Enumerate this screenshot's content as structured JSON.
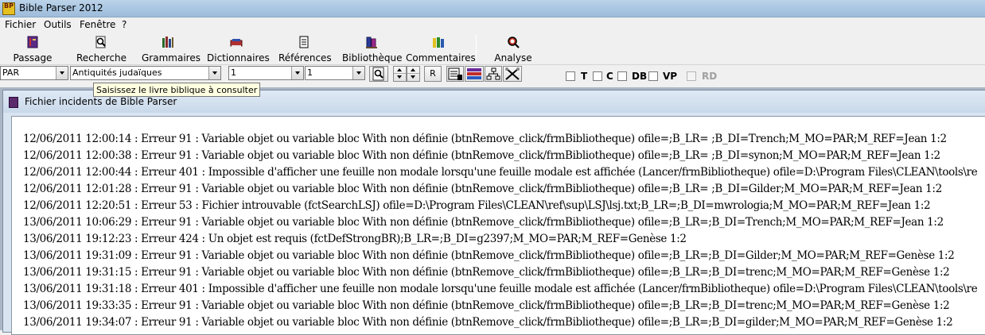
{
  "window": {
    "title": "Bible Parser 2012",
    "app_icon": "BP"
  },
  "menu": [
    {
      "label": "Fichier",
      "accel": "F"
    },
    {
      "label": "Outils",
      "accel": "O"
    },
    {
      "label": "Fenêtre",
      "accel": "n"
    },
    {
      "label": "?",
      "accel": "?"
    }
  ],
  "toolbar": {
    "passage": "Passage",
    "recherche": "Recherche",
    "grammaires": "Grammaires",
    "dictionnaires": "Dictionnaires",
    "references": "Références",
    "bibliotheque": "Bibliothèque",
    "commentaires": "Commentaires",
    "analyse": "Analyse"
  },
  "selectors": {
    "version": "PAR",
    "book": "Antiquités judaïques",
    "chapter": "1",
    "verse": "1",
    "r_button": "R"
  },
  "checkboxes": [
    {
      "label": "T",
      "checked": false,
      "enabled": true
    },
    {
      "label": "C",
      "checked": false,
      "enabled": true
    },
    {
      "label": "DB",
      "checked": false,
      "enabled": true
    },
    {
      "label": "VP",
      "checked": false,
      "enabled": true
    },
    {
      "label": "RD",
      "checked": false,
      "enabled": false
    }
  ],
  "tooltip": "Saisissez le livre biblique à consulter",
  "child_window": {
    "title": "Fichier incidents de Bible Parser"
  },
  "log_lines": [
    "12/06/2011 12:00:14 : Erreur 91 : Variable objet ou variable bloc With non définie (btnRemove_click/frmBibliotheque) ofile=;B_LR= ;B_DI=Trench;M_MO=PAR;M_REF=Jean 1:2",
    "12/06/2011 12:00:38 : Erreur 91 : Variable objet ou variable bloc With non définie (btnRemove_click/frmBibliotheque) ofile=;B_LR= ;B_DI=synon;M_MO=PAR;M_REF=Jean 1:2",
    "12/06/2011 12:00:44 : Erreur 401 : Impossible d'afficher une feuille non modale lorsqu'une feuille modale est affichée (Lancer/frmBibliotheque) ofile=D:\\Program Files\\CLEAN\\tools\\re",
    "12/06/2011 12:01:28 : Erreur 91 : Variable objet ou variable bloc With non définie (btnRemove_click/frmBibliotheque) ofile=;B_LR= ;B_DI=Gilder;M_MO=PAR;M_REF=Jean 1:2",
    "12/06/2011 12:20:51 : Erreur 53 : Fichier introuvable (fctSearchLSJ) ofile=D:\\Program Files\\CLEAN\\ref\\sup\\LSJ\\lsj.txt;B_LR=;B_DI=mwrologia;M_MO=PAR;M_REF=Jean 1:2",
    "13/06/2011 10:06:29 : Erreur 91 : Variable objet ou variable bloc With non définie (btnRemove_click/frmBibliotheque) ofile=;B_LR=;B_DI=Trench;M_MO=PAR;M_REF=Jean 1:2",
    "13/06/2011 19:12:23 : Erreur 424 : Un objet est requis (fctDefStrongBR);B_LR=;B_DI=g2397;M_MO=PAR;M_REF=Genèse 1:2",
    "13/06/2011 19:31:09 : Erreur 91 : Variable objet ou variable bloc With non définie (btnRemove_click/frmBibliotheque) ofile=;B_LR=;B_DI=Gilder;M_MO=PAR;M_REF=Genèse 1:2",
    "13/06/2011 19:31:15 : Erreur 91 : Variable objet ou variable bloc With non définie (btnRemove_click/frmBibliotheque) ofile=;B_LR=;B_DI=trenc;M_MO=PAR;M_REF=Genèse 1:2",
    "13/06/2011 19:31:18 : Erreur 401 : Impossible d'afficher une feuille non modale lorsqu'une feuille modale est affichée (Lancer/frmBibliotheque) ofile=D:\\Program Files\\CLEAN\\tools\\re",
    "13/06/2011 19:33:35 : Erreur 91 : Variable objet ou variable bloc With non définie (btnRemove_click/frmBibliotheque) ofile=;B_LR=;B_DI=trenc;M_MO=PAR;M_REF=Genèse 1:2",
    "13/06/2011 19:34:07 : Erreur 91 : Variable objet ou variable bloc With non définie (btnRemove_click/frmBibliotheque) ofile=;B_LR=;B_DI=gilder;M_MO=PAR;M_REF=Genèse 1:2"
  ]
}
